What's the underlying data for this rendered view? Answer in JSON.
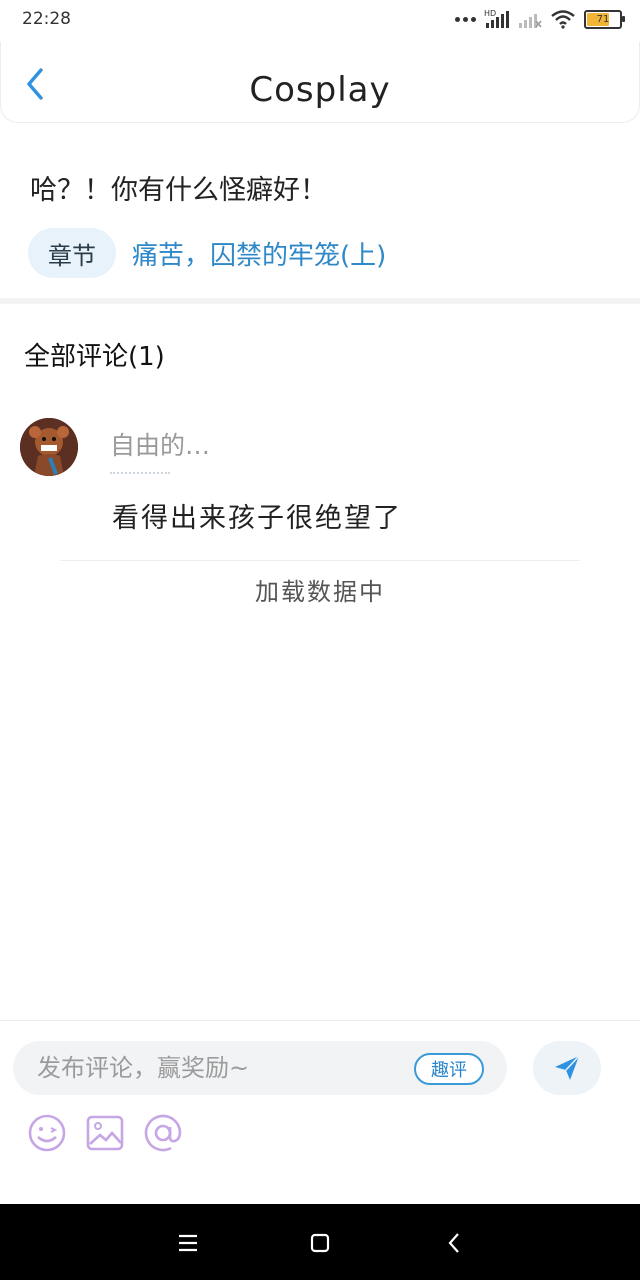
{
  "status_bar": {
    "time": "22:28",
    "network_label": "HD",
    "battery": "71",
    "battery_level": 0.71
  },
  "header": {
    "title": "Cosplay",
    "back_icon": "chevron-left-icon"
  },
  "post": {
    "title": "哈？！你有什么怪癖好！",
    "chapter_tag": "章节",
    "chapter_name": "痛苦，囚禁的牢笼(上)"
  },
  "comments": {
    "section_title": "全部评论(1)",
    "items": [
      {
        "user": "自由的…",
        "text": "看得出来孩子很绝望了"
      }
    ],
    "loading_text": "加载数据中"
  },
  "composer": {
    "placeholder": "发布评论，赢奖励~",
    "badge": "趣评",
    "send_icon": "send-icon",
    "tools": [
      "emoji-icon",
      "image-icon",
      "at-icon"
    ]
  },
  "colors": {
    "accent": "#2f88c8",
    "chapter_tag_bg": "#e7f2fb",
    "tool_icon": "#c7a6e6"
  },
  "nav_bar": [
    "menu-icon",
    "home-square-icon",
    "back-triangle-icon"
  ]
}
